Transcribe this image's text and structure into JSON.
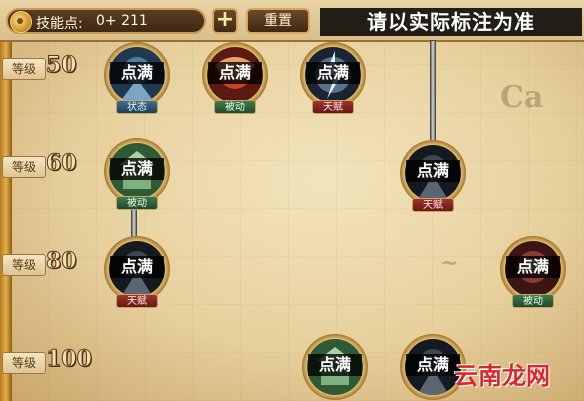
{
  "topbar": {
    "skill_points_label": "技能点:",
    "skill_points_value": "0+ 211",
    "plus_label": "+",
    "reset_label": "重置",
    "notice": "请以实际标注为准"
  },
  "levels": [
    {
      "tag": "等级",
      "value": "50"
    },
    {
      "tag": "等级",
      "value": "60"
    },
    {
      "tag": "等级",
      "value": "80"
    },
    {
      "tag": "等级",
      "value": "100"
    }
  ],
  "skills": [
    {
      "label": "点满",
      "type": "状态",
      "icon": "blue-warrior-icon"
    },
    {
      "label": "点满",
      "type": "被动",
      "icon": "red-dragon-icon"
    },
    {
      "label": "点满",
      "type": "天赋",
      "icon": "lightning-warrior-icon"
    },
    {
      "label": "点满",
      "type": "被动",
      "icon": "green-fortress-icon"
    },
    {
      "label": "点满",
      "type": "天赋",
      "icon": "dark-knight-icon"
    },
    {
      "label": "点满",
      "type": "天赋",
      "icon": "dark-knight-icon"
    },
    {
      "label": "点满",
      "type": "被动",
      "icon": "red-helmet-icon"
    },
    {
      "label": "点满",
      "type": "",
      "icon": "green-fortress-icon"
    },
    {
      "label": "点满",
      "type": "",
      "icon": "dark-knight-icon"
    }
  ],
  "watermark": "云南龙网",
  "colors": {
    "badge_status": "#2f5a78",
    "badge_passive": "#2f6a3f",
    "badge_talent": "#8a2821",
    "notice_bg": "#000000",
    "watermark": "#d7282a"
  }
}
